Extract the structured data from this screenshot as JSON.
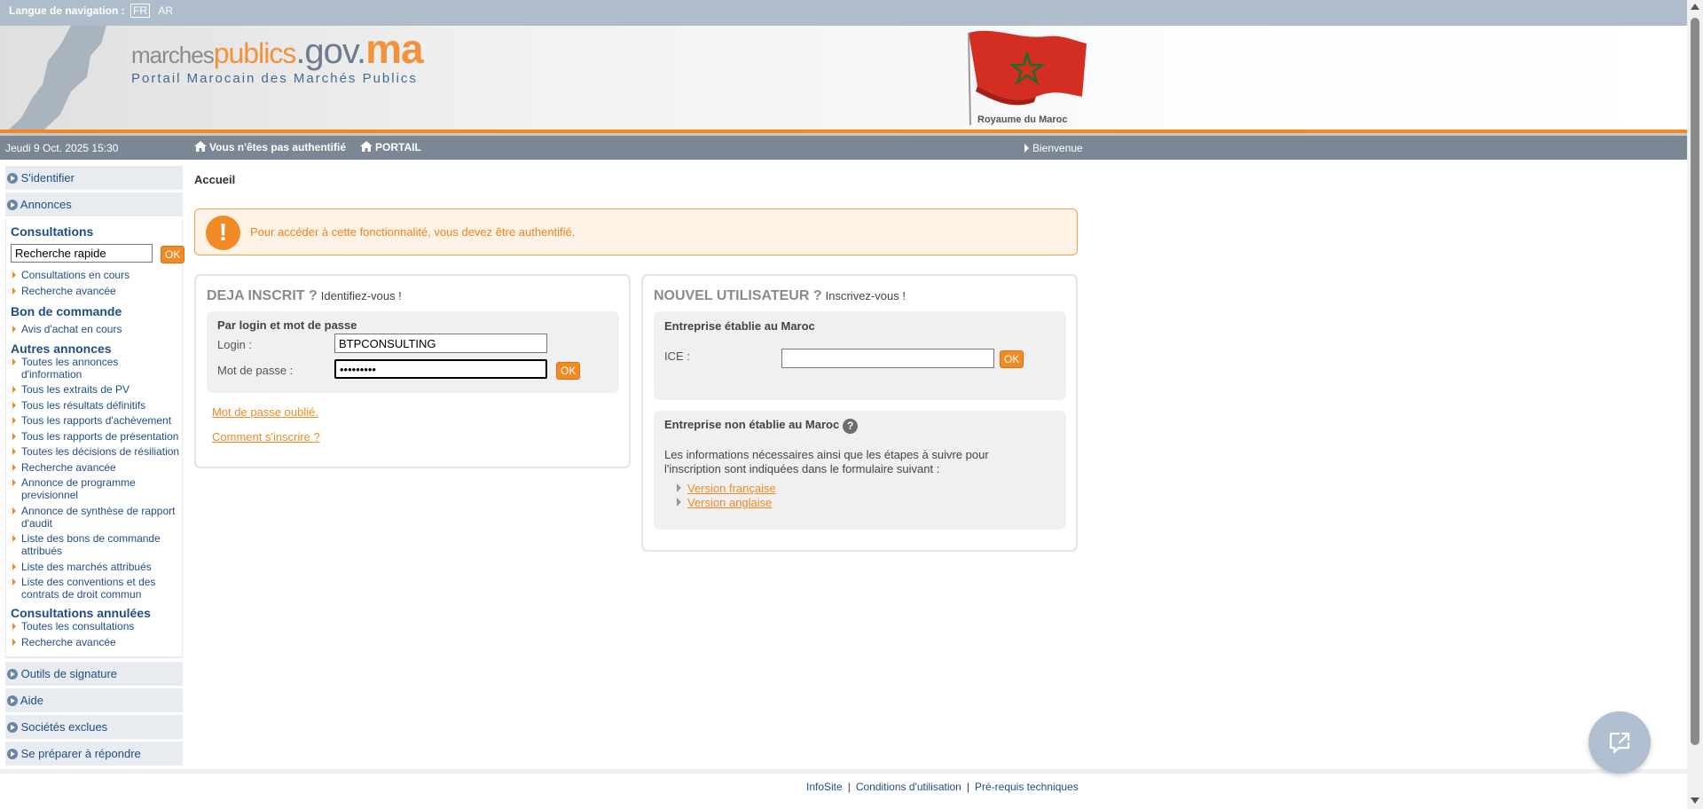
{
  "langbar": {
    "label": "Langue de navigation :",
    "lang_fr": "FR",
    "lang_ar": "AR"
  },
  "header": {
    "logo_marches": "marches",
    "logo_publics": "publics",
    "logo_gov": ".gov.",
    "logo_ma": "ma",
    "tagline": "Portail Marocain des Marchés Publics",
    "royaume": "Royaume du Maroc"
  },
  "statusbar": {
    "date": "Jeudi 9 Oct. 2025 15:30",
    "auth": "Vous n'êtes pas authentifié",
    "portail": "PORTAIL",
    "bienvenue": "Bienvenue"
  },
  "sidebar": {
    "sidentifier": "S'identifier",
    "annonces": "Annonces",
    "consultations_title": "Consultations",
    "search_value": "Recherche rapide",
    "ok": "OK",
    "consultations_links": [
      "Consultations en cours",
      "Recherche avancée"
    ],
    "bon_title": "Bon de commande",
    "bon_links": [
      "Avis d'achat en cours"
    ],
    "autres_title": "Autres annonces",
    "autres_links": [
      "Toutes les annonces d'information",
      "Tous les extraits de PV",
      "Tous les résultats définitifs",
      "Tous les rapports d'achèvement",
      "Tous les rapports de présentation",
      "Toutes les décisions de résiliation",
      "Recherche avancée",
      "Annonce de programme previsionnel",
      "Annonce de synthèse de rapport d'audit",
      "Liste des bons de commande attribués",
      "Liste des marchés attribués",
      "Liste des conventions et des contrats de droit commun"
    ],
    "annuelles_title": "Consultations annulées",
    "annuelles_links": [
      "Toutes les consultations",
      "Recherche avancée"
    ],
    "outils": "Outils de signature",
    "aide": "Aide",
    "societes": "Sociétés exclues",
    "preparer": "Se préparer à répondre"
  },
  "main": {
    "breadcrumb": "Accueil",
    "alert": "Pour accéder à cette fonctionnalité, vous devez être authentifié.",
    "deja": {
      "title": "DEJA INSCRIT ?",
      "subtitle": "Identifiez-vous !",
      "section": "Par login et mot de passe",
      "login_label": "Login :",
      "login_value": "BTPCONSULTING",
      "password_label": "Mot de passe :",
      "password_value": "•••••••••",
      "ok": "OK",
      "forgot": "Mot de passe oublié.",
      "how": "Comment s'inscrire ?"
    },
    "nouvel": {
      "title": "NOUVEL UTILISATEUR ?",
      "subtitle": "Inscrivez-vous !",
      "maroc_section": "Entreprise établie au Maroc",
      "ice_label": "ICE :",
      "ice_value": "",
      "ok": "OK",
      "non_section": "Entreprise non établie au Maroc",
      "info": "Les informations nécessaires ainsi que les étapes à suivre pour l'inscription sont indiquées dans le formulaire suivant :",
      "version_fr": "Version française",
      "version_en": "Version anglaise"
    }
  },
  "footer": {
    "infosite": "InfoSite",
    "conditions": "Conditions d'utilisation",
    "prerequis": "Pré-requis techniques"
  },
  "colors": {
    "accent": "#f08a24",
    "nav": "#1f4e86",
    "statusbar": "#7b8794",
    "langbar": "#aebccb"
  }
}
